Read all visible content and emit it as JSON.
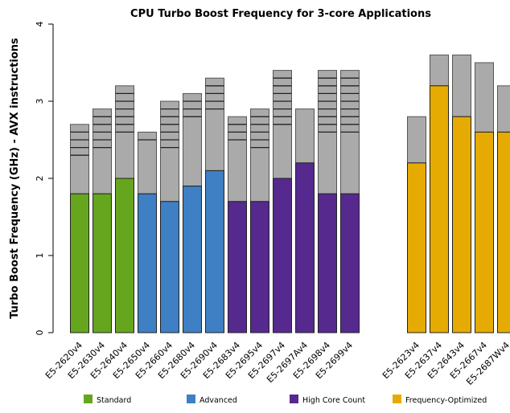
{
  "chart_data": {
    "type": "bar",
    "title": "CPU Turbo Boost Frequency for 3-core Applications",
    "ylabel": "Turbo Boost Frequency (GHz) - AVX instructions",
    "xlabel": "",
    "ylim": [
      0,
      4
    ],
    "yticks": [
      "0",
      "1",
      "2",
      "3",
      "4"
    ],
    "grid": false,
    "legend_placement": "bottom",
    "stacked_top_color": "#aaaaaa",
    "groups": [
      {
        "name": "Standard",
        "color": "#66a61e"
      },
      {
        "name": "Advanced",
        "color": "#3f7fc4"
      },
      {
        "name": "High Core Count",
        "color": "#56298f"
      },
      {
        "name": "Frequency-Optimized",
        "color": "#e6ab02"
      }
    ],
    "bars": [
      {
        "label": "E5-2620v4",
        "group": 0,
        "base": 1.8,
        "top": 2.7,
        "step_lines_from": 2.3
      },
      {
        "label": "E5-2630v4",
        "group": 0,
        "base": 1.8,
        "top": 2.9,
        "step_lines_from": 2.4
      },
      {
        "label": "E5-2640v4",
        "group": 0,
        "base": 2.0,
        "top": 3.2,
        "step_lines_from": 2.6
      },
      {
        "label": "E5-2650v4",
        "group": 1,
        "base": 1.8,
        "top": 2.6,
        "step_lines_from": 2.5
      },
      {
        "label": "E5-2660v4",
        "group": 1,
        "base": 1.7,
        "top": 3.0,
        "step_lines_from": 2.4
      },
      {
        "label": "E5-2680v4",
        "group": 1,
        "base": 1.9,
        "top": 3.1,
        "step_lines_from": 2.8
      },
      {
        "label": "E5-2690v4",
        "group": 1,
        "base": 2.1,
        "top": 3.3,
        "step_lines_from": 2.9
      },
      {
        "label": "E5-2683v4",
        "group": 2,
        "base": 1.7,
        "top": 2.8,
        "step_lines_from": 2.5
      },
      {
        "label": "E5-2695v4",
        "group": 2,
        "base": 1.7,
        "top": 2.9,
        "step_lines_from": 2.4
      },
      {
        "label": "E5-2697v4",
        "group": 2,
        "base": 2.0,
        "top": 3.4,
        "step_lines_from": 2.7
      },
      {
        "label": "E5-2697Av4",
        "group": 2,
        "base": 2.2,
        "top": 2.9,
        "step_lines_from": null
      },
      {
        "label": "E5-2698v4",
        "group": 2,
        "base": 1.8,
        "top": 3.4,
        "step_lines_from": 2.6
      },
      {
        "label": "E5-2699v4",
        "group": 2,
        "base": 1.8,
        "top": 3.4,
        "step_lines_from": 2.6
      },
      {
        "label": "E5-2623v4",
        "group": 3,
        "base": 2.2,
        "top": 2.8,
        "step_lines_from": null
      },
      {
        "label": "E5-2637v4",
        "group": 3,
        "base": 3.2,
        "top": 3.6,
        "step_lines_from": null
      },
      {
        "label": "E5-2643v4",
        "group": 3,
        "base": 2.8,
        "top": 3.6,
        "step_lines_from": null
      },
      {
        "label": "E5-2667v4",
        "group": 3,
        "base": 2.6,
        "top": 3.5,
        "step_lines_from": null
      },
      {
        "label": "E5-2687Wv4",
        "group": 3,
        "base": 2.6,
        "top": 3.2,
        "step_lines_from": null
      }
    ]
  }
}
